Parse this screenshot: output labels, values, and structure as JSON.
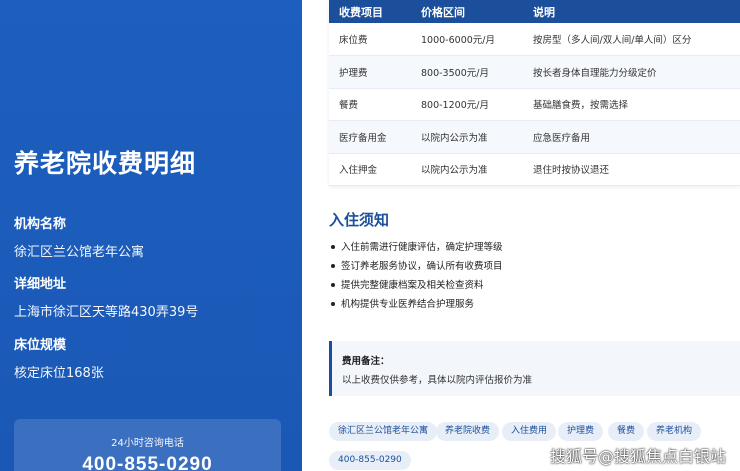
{
  "sidebar": {
    "title": "养老院收费明细",
    "institution_label": "机构名称",
    "institution_value": "徐汇区兰公馆老年公寓",
    "address_label": "详细地址",
    "address_value": "上海市徐汇区天等路430弄39号",
    "scale_label": "床位规模",
    "scale_value": "核定床位168张",
    "hotline_label": "24小时咨询电话",
    "hotline_number": "400-855-0290"
  },
  "fee_table": {
    "headers": [
      "收费项目",
      "价格区间",
      "说明"
    ],
    "rows": [
      [
        "床位费",
        "1000-6000元/月",
        "按房型（多人间/双人间/单人间）区分"
      ],
      [
        "护理费",
        "800-3500元/月",
        "按长者身体自理能力分级定价"
      ],
      [
        "餐费",
        "800-1200元/月",
        "基础膳食费，按需选择"
      ],
      [
        "医疗备用金",
        "以院内公示为准",
        "应急医疗备用"
      ],
      [
        "入住押金",
        "以院内公示为准",
        "退住时按协议退还"
      ]
    ]
  },
  "notice": {
    "title": "入住须知",
    "items": [
      "入住前需进行健康评估，确定护理等级",
      "签订养老服务协议，确认所有收费项目",
      "提供完整健康档案及相关检查资料",
      "机构提供专业医养结合护理服务"
    ]
  },
  "remark": {
    "label": "费用备注：",
    "text": "以上收费仅供参考，具体以院内评估报价为准"
  },
  "tags": [
    "徐汇区兰公馆老年公寓",
    "养老院收费",
    "入住费用",
    "护理费",
    "餐费",
    "养老机构",
    "400-855-0290"
  ],
  "watermark": "搜狐号@搜狐焦点白银站",
  "colors": {
    "primary": "#1b58b5",
    "header": "#1b4f9c",
    "tag_bg": "#e7eef8"
  }
}
